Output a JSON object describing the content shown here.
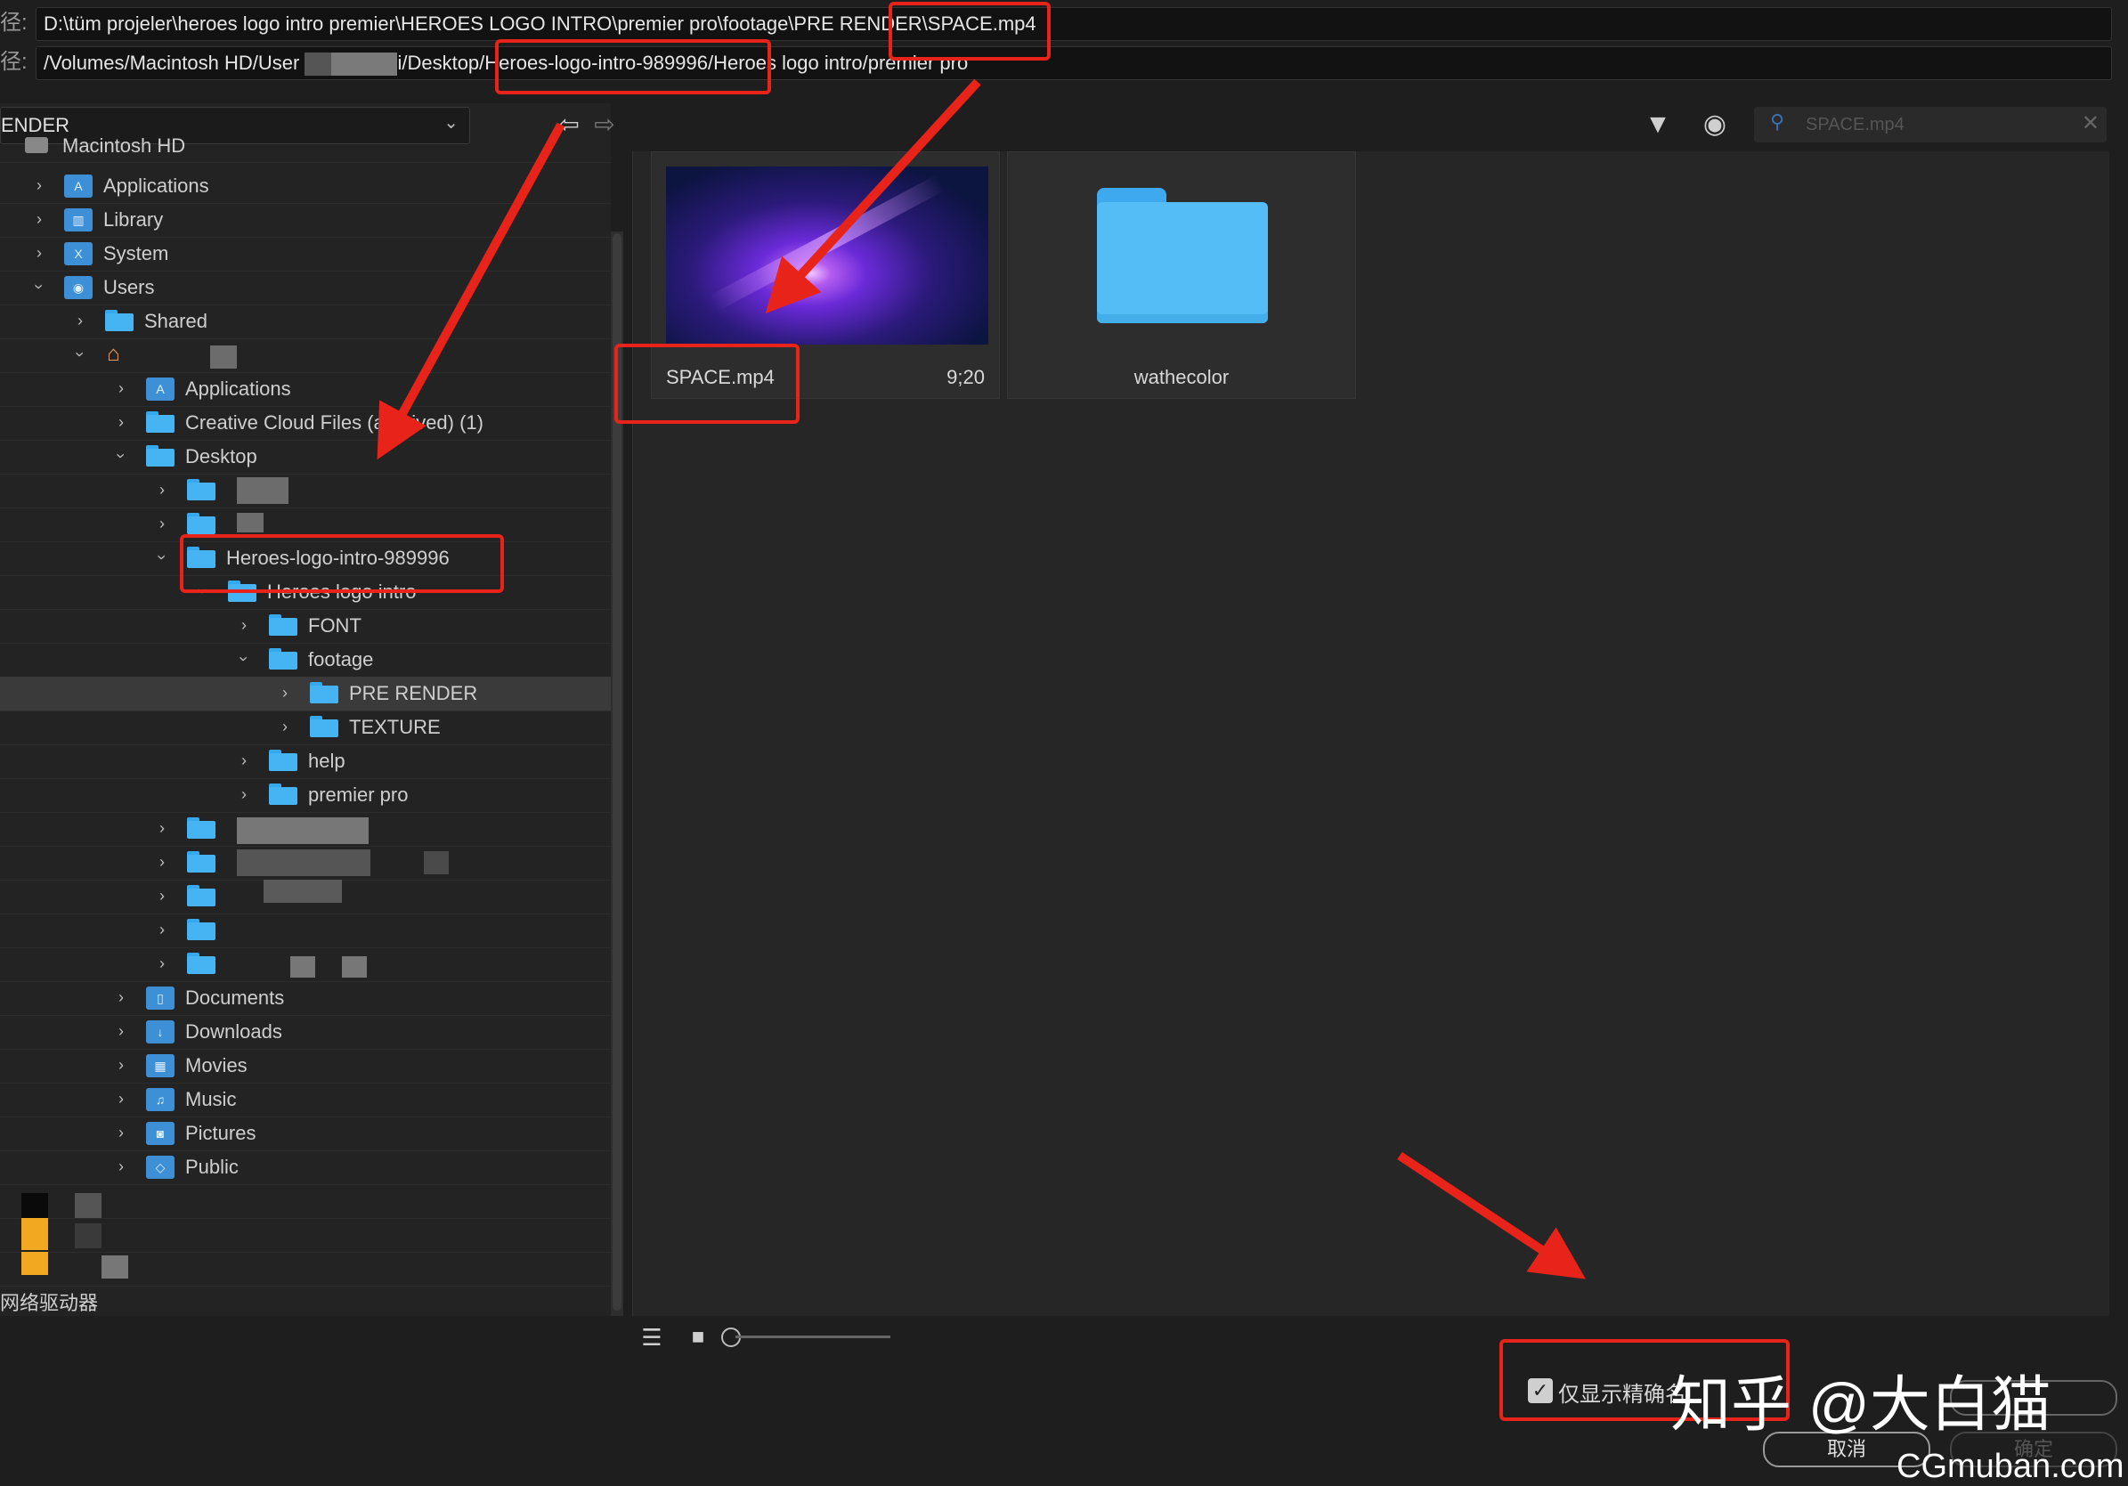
{
  "paths": {
    "label": "径:",
    "windows_path": "D:\\tüm projeler\\heroes logo intro premier\\HEROES LOGO INTRO\\premier pro\\footage\\PRE RENDER\\SPACE.mp4",
    "mac_path_prefix": "/Volumes/Macintosh HD/User",
    "mac_path_suffix": "i/Desktop/Heroes-logo-intro-989996/Heroes logo intro/premier pro"
  },
  "location_dropdown": {
    "value": "ENDER"
  },
  "search": {
    "placeholder": "SPACE.mp4"
  },
  "tree": {
    "root": "Macintosh HD",
    "items": {
      "applications": "Applications",
      "library": "Library",
      "system": "System",
      "users": "Users",
      "shared": "Shared",
      "home_applications": "Applications",
      "creative_cloud": "Creative Cloud Files (archived) (1)",
      "desktop": "Desktop",
      "heroes_folder": "Heroes-logo-intro-989996",
      "heroes_sub": "Heroes logo intro",
      "font": "FONT",
      "footage": "footage",
      "pre_render": "PRE RENDER",
      "texture": "TEXTURE",
      "help": "help",
      "premier_pro": "premier pro",
      "documents": "Documents",
      "downloads": "Downloads",
      "movies": "Movies",
      "music": "Music",
      "pictures": "Pictures",
      "public": "Public"
    },
    "network": "网络驱动器"
  },
  "files": [
    {
      "name": "SPACE.mp4",
      "duration": "9;20",
      "type": "video"
    },
    {
      "name": "wathecolor",
      "type": "folder"
    }
  ],
  "bottom": {
    "checkbox_label": "仅显示精确名",
    "checkbox_checked": true,
    "cancel": "取消",
    "ok": "确定"
  },
  "watermarks": {
    "zhihu": "知乎 @大白猫",
    "site": "CGmuban.com"
  },
  "colors": {
    "accent_red": "#e8231a",
    "folder_blue": "#46b4f3",
    "background": "#1e1e1e"
  }
}
